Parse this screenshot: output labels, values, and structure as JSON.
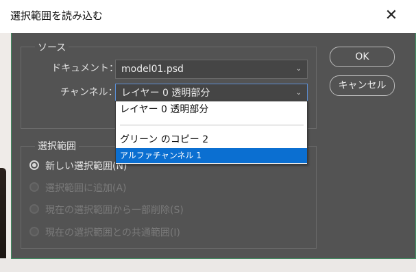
{
  "window": {
    "title": "選択範囲を読み込む",
    "close_glyph": "✕"
  },
  "source": {
    "legend": "ソース",
    "document_label": "ドキュメント：",
    "document_value": "model01.psd",
    "channel_label": "チャンネル：",
    "channel_value": "レイヤー 0 透明部分"
  },
  "channel_dropdown": {
    "options": [
      "レイヤー 0 透明部分",
      "グリーン のコピー 2",
      "アルファチャンネル 1"
    ],
    "highlighted_index": 2
  },
  "operation": {
    "legend": "選択範囲",
    "options": [
      {
        "label": "新しい選択範囲(N)",
        "selected": true,
        "enabled": true
      },
      {
        "label": "選択範囲に追加(A)",
        "selected": false,
        "enabled": false
      },
      {
        "label": "現在の選択範囲から一部削除(S)",
        "selected": false,
        "enabled": false
      },
      {
        "label": "現在の選択範囲との共通範囲(I)",
        "selected": false,
        "enabled": false
      }
    ]
  },
  "buttons": {
    "ok": "OK",
    "cancel": "キャンセル"
  },
  "icons": {
    "close": "close-icon",
    "dropdown": "chevron-down-icon"
  },
  "colors": {
    "panel": "#535353",
    "highlight": "#0b6fd1",
    "frame": "#3f8f62"
  }
}
